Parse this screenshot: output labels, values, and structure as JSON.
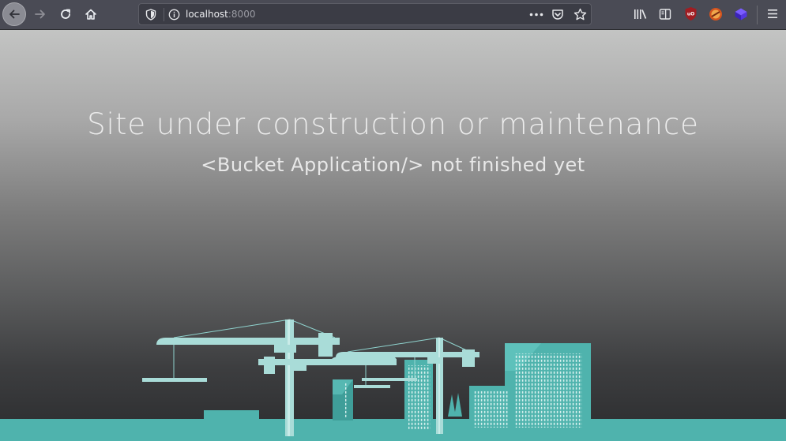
{
  "browser": {
    "url_host": "localhost",
    "url_port": ":8000",
    "icons": [
      "back-arrow-icon",
      "forward-arrow-icon",
      "reload-icon",
      "home-icon",
      "tracking-shield-icon",
      "site-info-icon",
      "page-actions-menu-icon",
      "pocket-icon",
      "bookmark-star-icon",
      "library-icon",
      "sidebar-icon",
      "ublock-origin-icon",
      "extension-icon",
      "extension-cube-icon",
      "hamburger-menu-icon"
    ]
  },
  "page": {
    "title": "Site under construction or maintenance",
    "subtitle": "<Bucket Application/> not finished yet"
  },
  "colors": {
    "toolbar": "#4a4b55",
    "urlbar": "#3b3c45",
    "illustration_teal": "#4fb3ad",
    "illustration_light": "#a9dcd8",
    "illustration_dark": "#3a9a95",
    "text": "#ececec"
  }
}
